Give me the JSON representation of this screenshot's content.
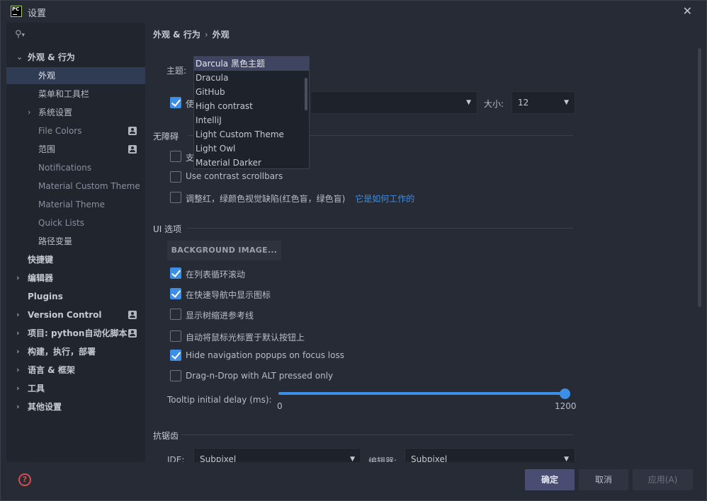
{
  "window": {
    "title": "设置",
    "app_icon_text": "PC"
  },
  "sidebar": {
    "search_icon": "search-icon",
    "items": [
      {
        "label": "外观 & 行为",
        "expanded": true
      },
      {
        "label": "外观"
      },
      {
        "label": "菜单和工具栏"
      },
      {
        "label": "系统设置"
      },
      {
        "label": "File Colors"
      },
      {
        "label": "范围"
      },
      {
        "label": "Notifications"
      },
      {
        "label": "Material Custom Theme"
      },
      {
        "label": "Material Theme"
      },
      {
        "label": "Quick Lists"
      },
      {
        "label": "路径变量"
      },
      {
        "label": "快捷键"
      },
      {
        "label": "编辑器"
      },
      {
        "label": "Plugins"
      },
      {
        "label": "Version Control"
      },
      {
        "label": "项目: python自动化脚本"
      },
      {
        "label": "构建，执行，部署"
      },
      {
        "label": "语言 & 框架"
      },
      {
        "label": "工具"
      },
      {
        "label": "其他设置"
      }
    ]
  },
  "breadcrumb": {
    "parent": "外观 & 行为",
    "separator": "›",
    "current": "外观"
  },
  "theme": {
    "label": "主题:",
    "options": [
      "Darcula 黑色主题",
      "Dracula",
      "GitHub",
      "High contrast",
      "IntelliJ",
      "Light Custom Theme",
      "Light Owl",
      "Material Darker"
    ],
    "selected": "Darcula 黑色主题"
  },
  "font": {
    "use_custom_prefix": "使",
    "size_label": "大小:",
    "size_value": "12"
  },
  "accessibility": {
    "title": "无障碍",
    "support_prefix": "支",
    "contrast_scrollbars": "Use contrast scrollbars",
    "color_deficiency": "调整红，绿颜色视觉缺陷(红色盲，绿色盲)",
    "how_it_works": "它是如何工作的"
  },
  "ui_options": {
    "title": "UI 选项",
    "background_image_button": "BACKGROUND IMAGE...",
    "cyclic_scrolling": {
      "label": "在列表循环滚动",
      "checked": true
    },
    "show_icons_nav": {
      "label": "在快速导航中显示图标",
      "checked": true
    },
    "tree_indent_guides": {
      "label": "显示树缩进参考线",
      "checked": false
    },
    "move_mouse_default": {
      "label": "自动将鼠标光标置于默认按钮上",
      "checked": false
    },
    "hide_nav_popups": {
      "label": "Hide navigation popups on focus loss",
      "checked": true
    },
    "drag_n_drop_alt": {
      "label": "Drag-n-Drop with ALT pressed only",
      "checked": false
    },
    "tooltip_delay": {
      "label": "Tooltip initial delay (ms):",
      "min": "0",
      "max": "1200",
      "value": 1200
    }
  },
  "antialiasing": {
    "title": "抗锯齿",
    "ide_label": "IDE:",
    "ide_value": "Subpixel",
    "editor_label": "编辑器:",
    "editor_value": "Subpixel"
  },
  "footer": {
    "ok": "确定",
    "cancel": "取消",
    "apply": "应用(A)"
  },
  "colors": {
    "accent": "#3d8ee6",
    "selection": "#2f3c53",
    "background": "#262b35"
  }
}
